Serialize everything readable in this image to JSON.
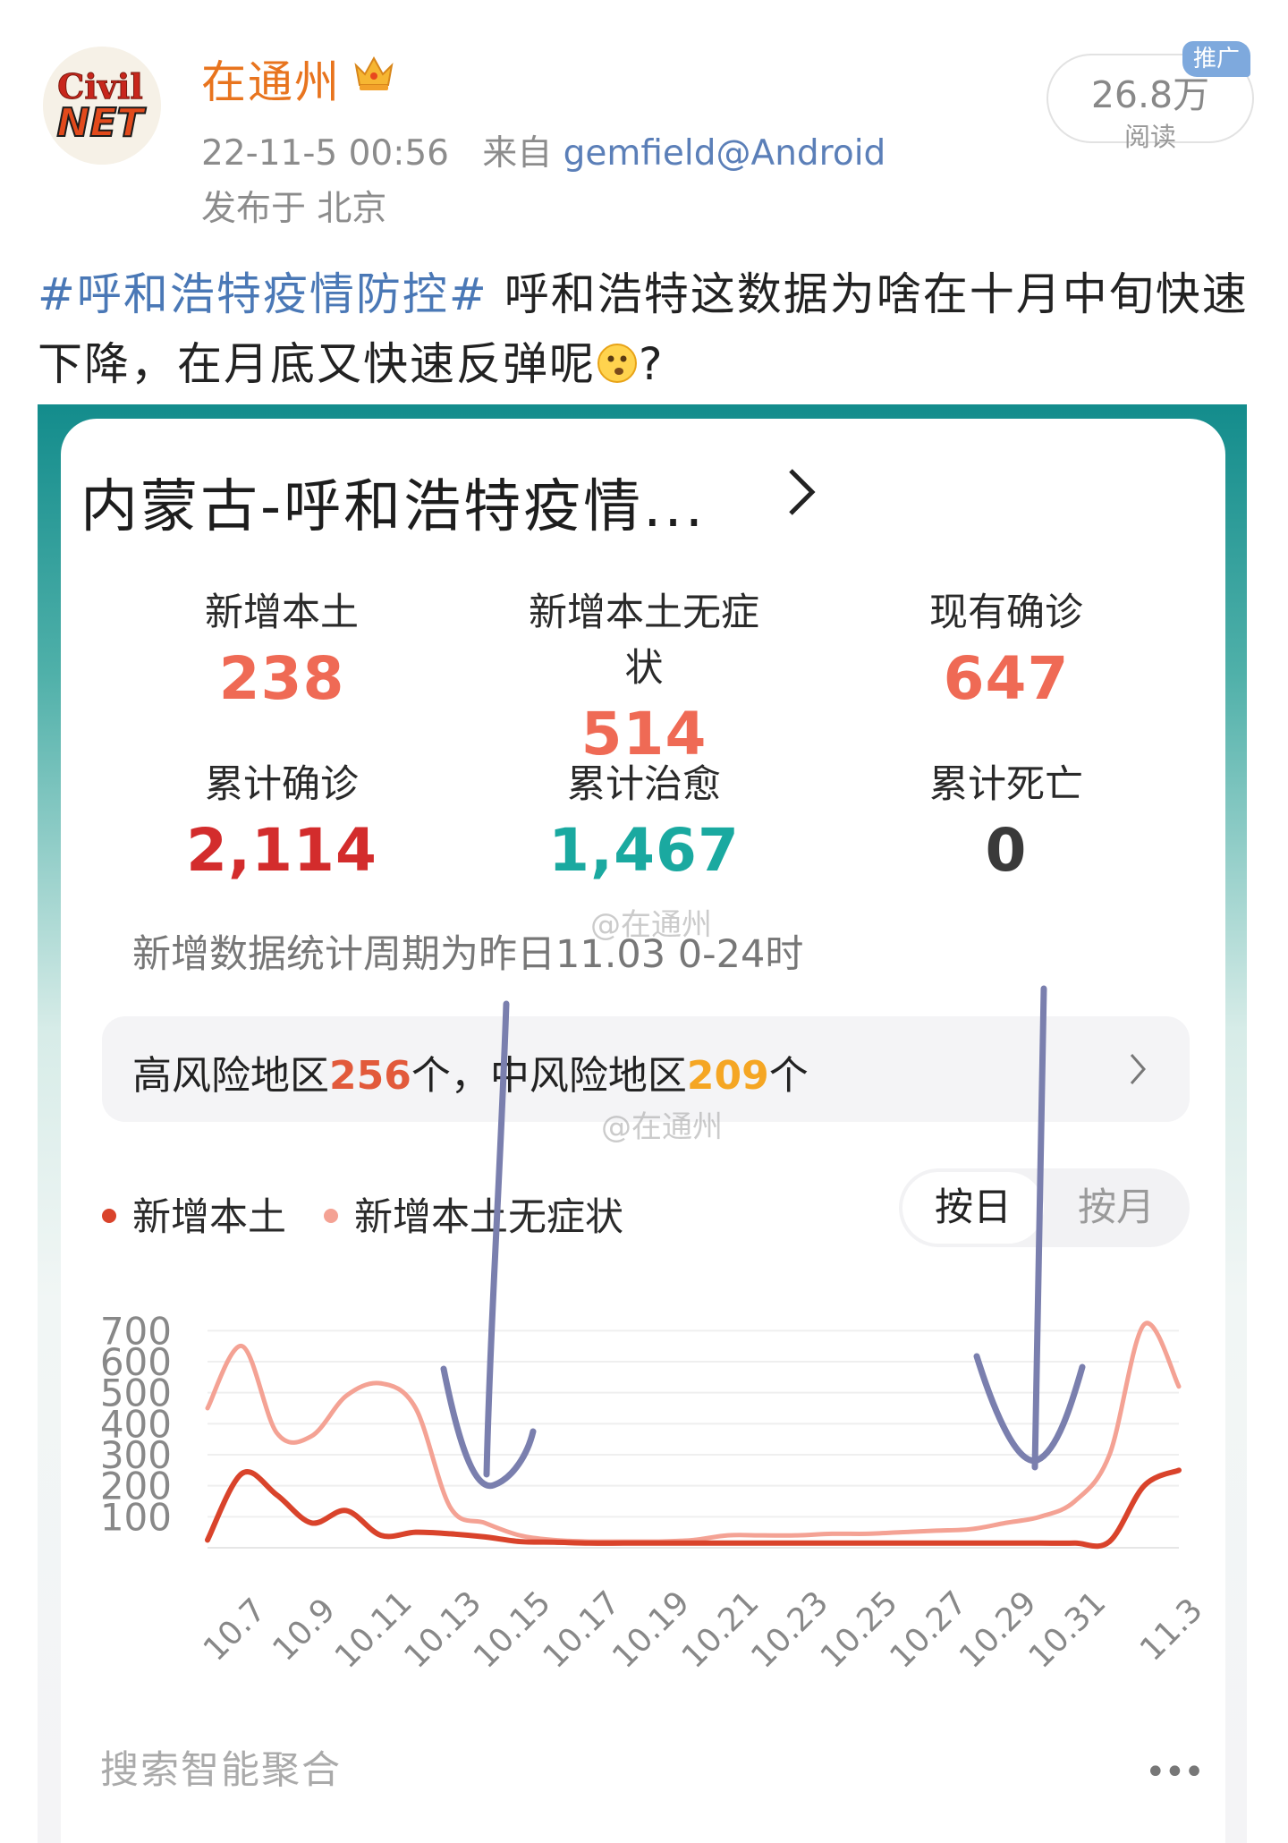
{
  "post": {
    "author": "在通州",
    "timestamp": "22-11-5 00:56",
    "from_label": "来自",
    "source": "gemfield@Android",
    "location": "发布于 北京",
    "reads": "26.8万",
    "reads_label": "阅读",
    "promo_badge": "推广",
    "hashtag": "#呼和浩特疫情防控#",
    "text": " 呼和浩特这数据为啥在十月中旬快速下降，在月底又快速反弹呢",
    "text_end": "?",
    "avatar_text_top": "Civil",
    "avatar_text_bottom": "NET"
  },
  "card": {
    "title": "内蒙古-呼和浩特疫情...",
    "stats": [
      {
        "label": "新增本土",
        "value": "238",
        "color": "#ef6a55"
      },
      {
        "label": "新增本土无症状",
        "value": "514",
        "color": "#ef6a55"
      },
      {
        "label": "现有确诊",
        "value": "647",
        "color": "#ef6a55"
      },
      {
        "label": "累计确诊",
        "value": "2,114",
        "color": "#d32c2c"
      },
      {
        "label": "累计治愈",
        "value": "1,467",
        "color": "#1aa9a0"
      },
      {
        "label": "累计死亡",
        "value": "0",
        "color": "#3a3a3a"
      }
    ],
    "period_note": "新增数据统计周期为昨日11.03 0-24时",
    "watermark": "@在通州",
    "risk": {
      "high_prefix": "高风险地区",
      "high_count": "256",
      "high_suffix": "个，",
      "mid_prefix": "中风险地区",
      "mid_count": "209",
      "mid_suffix": "个"
    },
    "toggle": {
      "day": "按日",
      "month": "按月"
    },
    "aggregate_label": "搜索智能聚合",
    "more_label": "•••"
  },
  "chart_data": {
    "type": "line",
    "x": [
      "10.6",
      "10.7",
      "10.8",
      "10.9",
      "10.10",
      "10.11",
      "10.12",
      "10.13",
      "10.14",
      "10.15",
      "10.16",
      "10.17",
      "10.18",
      "10.19",
      "10.20",
      "10.21",
      "10.22",
      "10.23",
      "10.24",
      "10.25",
      "10.26",
      "10.27",
      "10.28",
      "10.29",
      "10.30",
      "10.31",
      "11.1",
      "11.2",
      "11.3"
    ],
    "xticks": [
      "10.7",
      "10.9",
      "10.11",
      "10.13",
      "10.15",
      "10.17",
      "10.19",
      "10.21",
      "10.23",
      "10.25",
      "10.27",
      "10.29",
      "10.31",
      "11.3"
    ],
    "yticks": [
      100,
      200,
      300,
      400,
      500,
      600,
      700
    ],
    "ylim": [
      0,
      750
    ],
    "grid": true,
    "legend_position": "top-left",
    "series": [
      {
        "name": "新增本土",
        "color": "#d9432b",
        "values": [
          25,
          240,
          170,
          80,
          120,
          40,
          50,
          45,
          35,
          20,
          18,
          15,
          15,
          15,
          15,
          15,
          15,
          15,
          15,
          15,
          15,
          15,
          15,
          15,
          15,
          15,
          20,
          200,
          250
        ]
      },
      {
        "name": "新增本土无症状",
        "color": "#f4a294",
        "values": [
          450,
          650,
          370,
          360,
          490,
          530,
          450,
          130,
          80,
          40,
          25,
          20,
          20,
          20,
          25,
          40,
          40,
          40,
          45,
          45,
          50,
          55,
          60,
          80,
          100,
          150,
          300,
          720,
          520
        ]
      }
    ]
  }
}
